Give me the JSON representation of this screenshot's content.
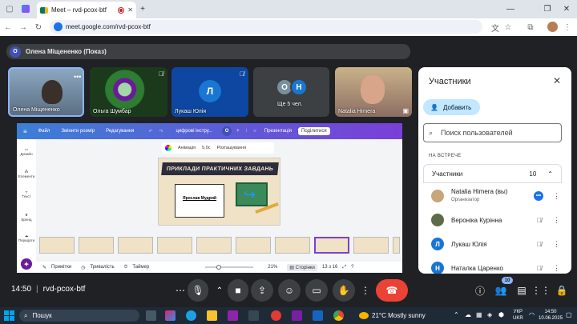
{
  "browser": {
    "tab_title": "Meet – rvd-pcox-btf",
    "url": "meet.google.com/rvd-pcox-btf",
    "new_tab_glyph": "+",
    "close_tab_glyph": "✕"
  },
  "presenter": {
    "initial": "О",
    "label": "Олена Міщененко (Показ)"
  },
  "tiles": [
    {
      "name": "Олена Міщененко"
    },
    {
      "name": "Ольга Шумбар"
    },
    {
      "name": "Лукаш Юлія",
      "initial": "Л"
    },
    {
      "name": "Ще 5 чел.",
      "initials": [
        "О",
        "Н"
      ]
    },
    {
      "name": "Natalia Himera"
    }
  ],
  "canva": {
    "menu_file": "Файл",
    "resize": "Змінити розмір",
    "edit": "Редагування",
    "doc_title": "цифрові інстру...",
    "present": "Презентація",
    "share": "Поділитися",
    "side_items": [
      "Дизайн",
      "Елементи",
      "Текст",
      "Бренд",
      "Передати"
    ],
    "toolbar_animation": "Анімація",
    "toolbar_duration": "5,0с",
    "toolbar_position": "Розташування",
    "slide_title": "ПРИКЛАДИ ПРАКТИЧНИХ ЗАВДАНЬ",
    "slide_author": "Ярослав Мудрий",
    "bottom_notes": "Примітки",
    "bottom_duration": "Тривалість",
    "bottom_timer": "Таймер",
    "zoom": "21%",
    "pages_label": "Сторінки",
    "page_counter": "13 з 16"
  },
  "panel": {
    "title": "Участники",
    "add_button": "Добавить",
    "search_placeholder": "Поиск пользователей",
    "section": "НА ВСТРЕЧЕ",
    "group_label": "Участники",
    "group_count": "10",
    "participants": [
      {
        "name": "Natalia Himera (вы)",
        "sub": "Организатор"
      },
      {
        "name": "Вероніка Курінна",
        "sub": ""
      },
      {
        "name": "Лукаш Юлія",
        "sub": "",
        "initial": "Л"
      },
      {
        "name": "Наталка Царенко",
        "sub": "",
        "initial": "Н"
      }
    ]
  },
  "meeting": {
    "time": "14:50",
    "separator": "|",
    "code": "rvd-pcox-btf",
    "people_badge": "10"
  },
  "taskbar": {
    "search": "Пошук",
    "weather": "21°C  Mostly sunny",
    "lang1": "УКР",
    "lang2": "UKR",
    "clock": "14:50",
    "date": "10.06.2025"
  },
  "colors": {
    "meet_dark": "#202124",
    "accent_blue": "#1a73e8",
    "end_call_red": "#ea4335",
    "panel_add_bg": "#c2e7ff"
  }
}
